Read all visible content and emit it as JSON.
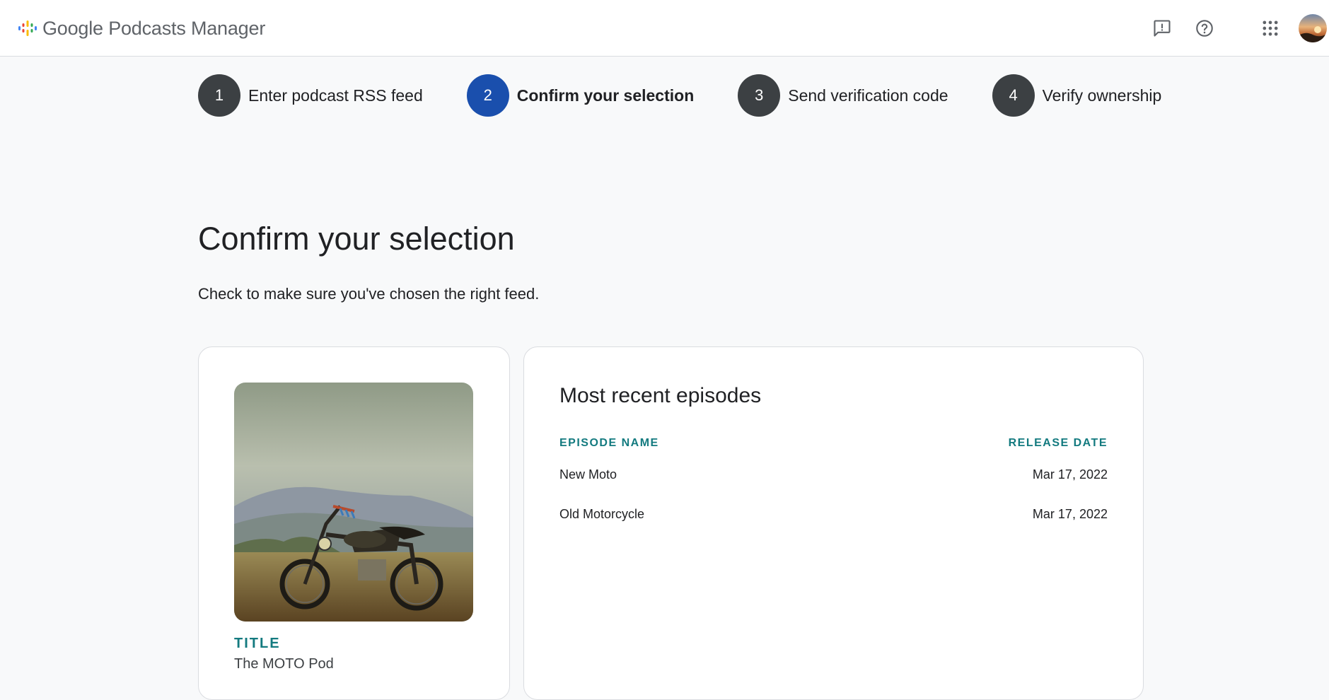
{
  "header": {
    "brand_google": "Google",
    "brand_product": "Podcasts Manager",
    "icons": [
      "podcasts-logo-icon",
      "feedback-icon",
      "help-icon",
      "apps-grid-icon",
      "avatar"
    ]
  },
  "stepper": {
    "steps": [
      {
        "number": "1",
        "label": "Enter podcast RSS feed"
      },
      {
        "number": "2",
        "label": "Confirm your selection"
      },
      {
        "number": "3",
        "label": "Send verification code"
      },
      {
        "number": "4",
        "label": "Verify ownership"
      }
    ]
  },
  "main": {
    "title": "Confirm your selection",
    "subtitle": "Check to make sure you've chosen the right feed."
  },
  "podcast": {
    "title_label": "TITLE",
    "title_value": "The MOTO Pod"
  },
  "episodes": {
    "heading": "Most recent episodes",
    "columns": {
      "name": "EPISODE NAME",
      "date": "RELEASE DATE"
    },
    "rows": [
      {
        "name": "New Moto",
        "date": "Mar 17, 2022"
      },
      {
        "name": "Old Motorcycle",
        "date": "Mar 17, 2022"
      }
    ]
  },
  "colors": {
    "active_step": "#1a4fad",
    "inactive_step": "#3c4043",
    "accent_teal": "#137a7f"
  }
}
